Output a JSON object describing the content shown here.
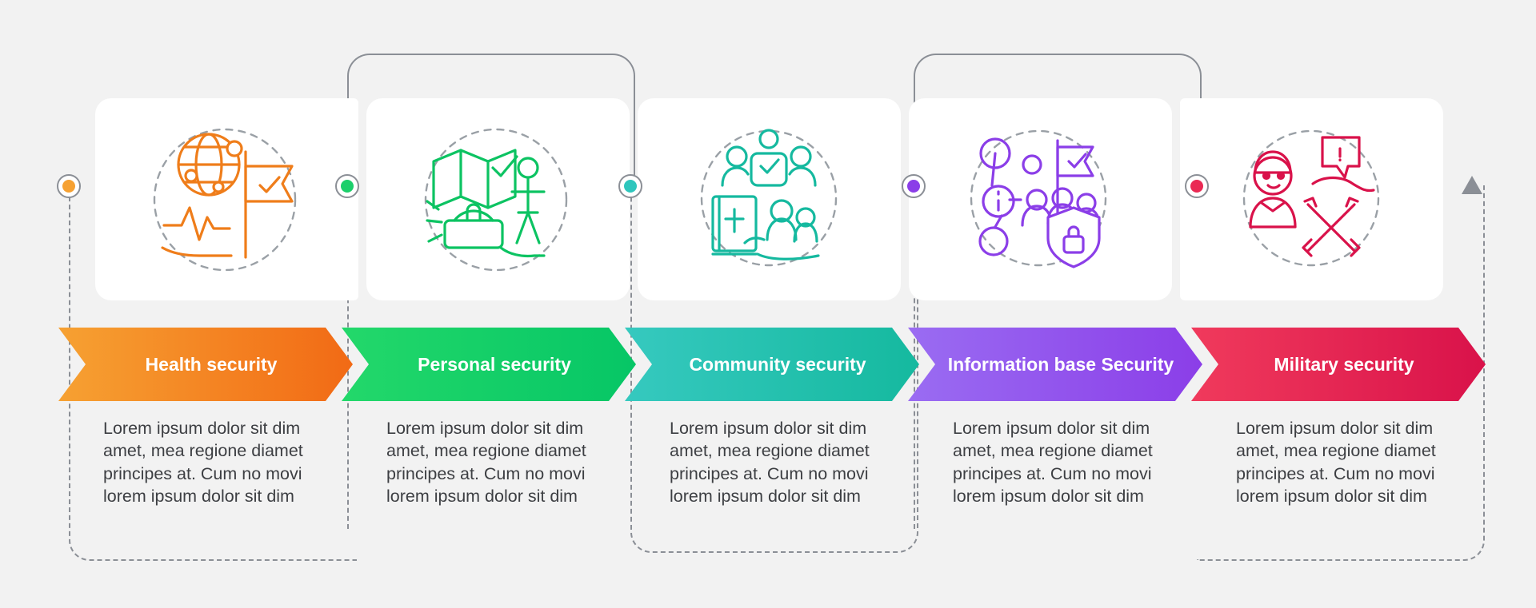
{
  "diagram": {
    "type": "process-infographic",
    "steps": [
      {
        "label": "Health security",
        "color": "#f26a15",
        "body": "Lorem ipsum dolor sit dim amet, mea regione diamet principes at. Cum no movi lorem ipsum dolor sit dim",
        "icon": "globe-heartbeat-flag-icon"
      },
      {
        "label": "Personal security",
        "color": "#06c666",
        "body": "Lorem ipsum dolor sit dim amet, mea regione diamet principes at. Cum no movi lorem ipsum dolor sit dim",
        "icon": "map-person-siren-icon"
      },
      {
        "label": "Community security",
        "color": "#15b99f",
        "body": "Lorem ipsum dolor sit dim amet, mea regione diamet principes at. Cum no movi lorem ipsum dolor sit dim",
        "icon": "community-book-people-icon"
      },
      {
        "label": "Information base Security",
        "color": "#8b3ee8",
        "body": "Lorem ipsum dolor sit dim amet, mea regione diamet principes at. Cum no movi lorem ipsum dolor sit dim",
        "icon": "information-network-shield-lock-icon"
      },
      {
        "label": "Military security",
        "color": "#d9124a",
        "body": "Lorem ipsum dolor sit dim amet, mea regione diamet principes at. Cum no movi lorem ipsum dolor sit dim",
        "icon": "soldier-swords-shield-icon"
      }
    ],
    "nodes": [
      {
        "color": "#f6a132"
      },
      {
        "color": "#1ccf6b"
      },
      {
        "color": "#2ec6bd"
      },
      {
        "color": "#8b3ee8"
      },
      {
        "color": "#ea2a54"
      }
    ],
    "background": "#f2f2f2",
    "connector_color": "#8b8f96"
  }
}
